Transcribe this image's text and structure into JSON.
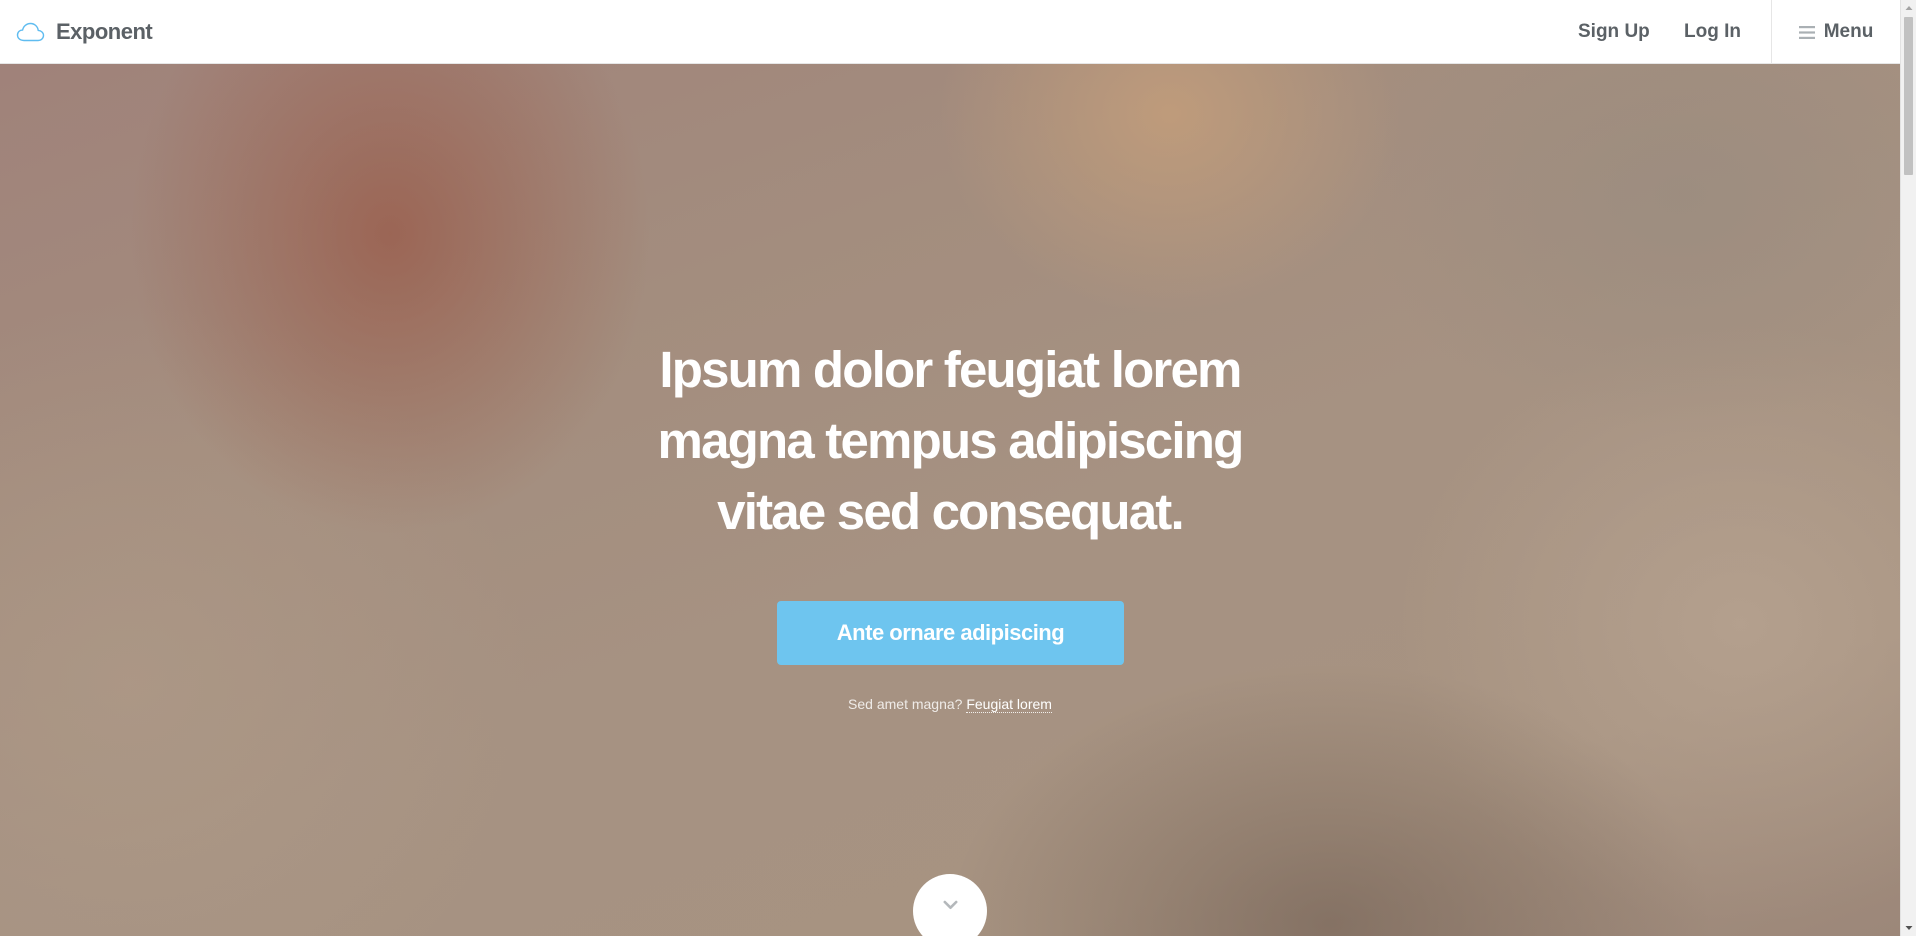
{
  "header": {
    "brand": {
      "name": "Exponent",
      "icon": "cloud-icon",
      "icon_color": "#5fbcf0"
    },
    "nav": {
      "sign_up": "Sign Up",
      "log_in": "Log In",
      "menu": "Menu",
      "menu_icon": "hamburger-icon"
    }
  },
  "hero": {
    "headline_lines": [
      "Ipsum dolor feugiat lorem",
      "magna tempus adipiscing",
      "vitae sed consequat."
    ],
    "cta_label": "Ante ornare adipiscing",
    "subline_text": "Sed amet magna?",
    "subline_link": "Feugiat lorem",
    "scroll_icon": "chevron-down-icon"
  },
  "colors": {
    "accent": "#6ec5ef",
    "nav_text": "#5b6166",
    "hero_text": "#ffffff"
  }
}
